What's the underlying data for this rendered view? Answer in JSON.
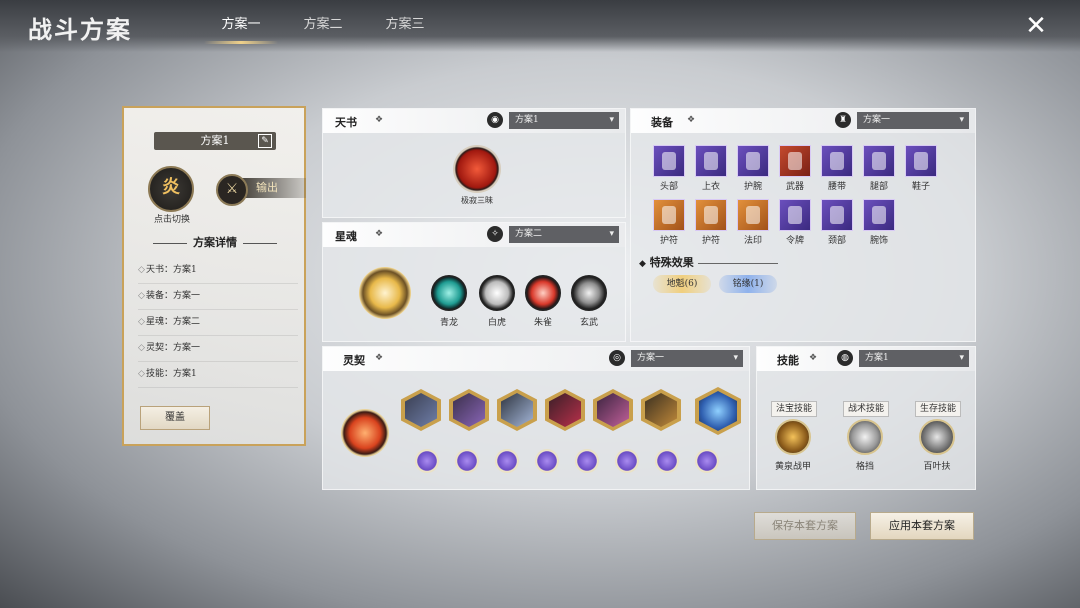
{
  "header": {
    "title": "战斗方案",
    "tabs": [
      "方案一",
      "方案二",
      "方案三"
    ]
  },
  "left_card": {
    "plan_name": "方案1",
    "element_glyph": "炎",
    "element_caption": "点击切换",
    "output_label": "输出",
    "detail_title": "方案详情",
    "details": [
      "天书：方案1",
      "装备：方案一",
      "星魂：方案二",
      "灵契：方案一",
      "技能：方案1"
    ],
    "cover_button": "覆盖"
  },
  "tianshu": {
    "title": "天书",
    "select_value": "方案1",
    "orb_label": "极寂三昧"
  },
  "xinghun": {
    "title": "星魂",
    "select_value": "方案二",
    "items": [
      "青龙",
      "白虎",
      "朱雀",
      "玄武"
    ]
  },
  "equipment": {
    "title": "装备",
    "select_value": "方案一",
    "row1": [
      "头部",
      "上衣",
      "护腕",
      "武器",
      "腰带",
      "腿部",
      "鞋子"
    ],
    "row2": [
      "护符",
      "护符",
      "法印",
      "令牌",
      "颈部",
      "腕饰"
    ],
    "special_title": "特殊效果",
    "special_badges": [
      "地魁(6)",
      "铭缘(1)"
    ]
  },
  "lingqi": {
    "title": "灵契",
    "select_value": "方案一"
  },
  "skills": {
    "title": "技能",
    "select_value": "方案1",
    "categories": [
      "法宝技能",
      "战术技能",
      "生存技能"
    ],
    "names": [
      "黄泉战甲",
      "格挡",
      "百叶扶"
    ]
  },
  "footer": {
    "save_button": "保存本套方案",
    "apply_button": "应用本套方案"
  },
  "colors": {
    "gold_accent": "#c9a25a",
    "select_bg": "#5f6064",
    "purple_quality": "#6b4fbd",
    "red_quality": "#c44a2e",
    "orange_quality": "#e2903b"
  },
  "icons": {
    "close": "close-icon",
    "edit": "edit-icon",
    "caret": "chevron-down-icon"
  }
}
